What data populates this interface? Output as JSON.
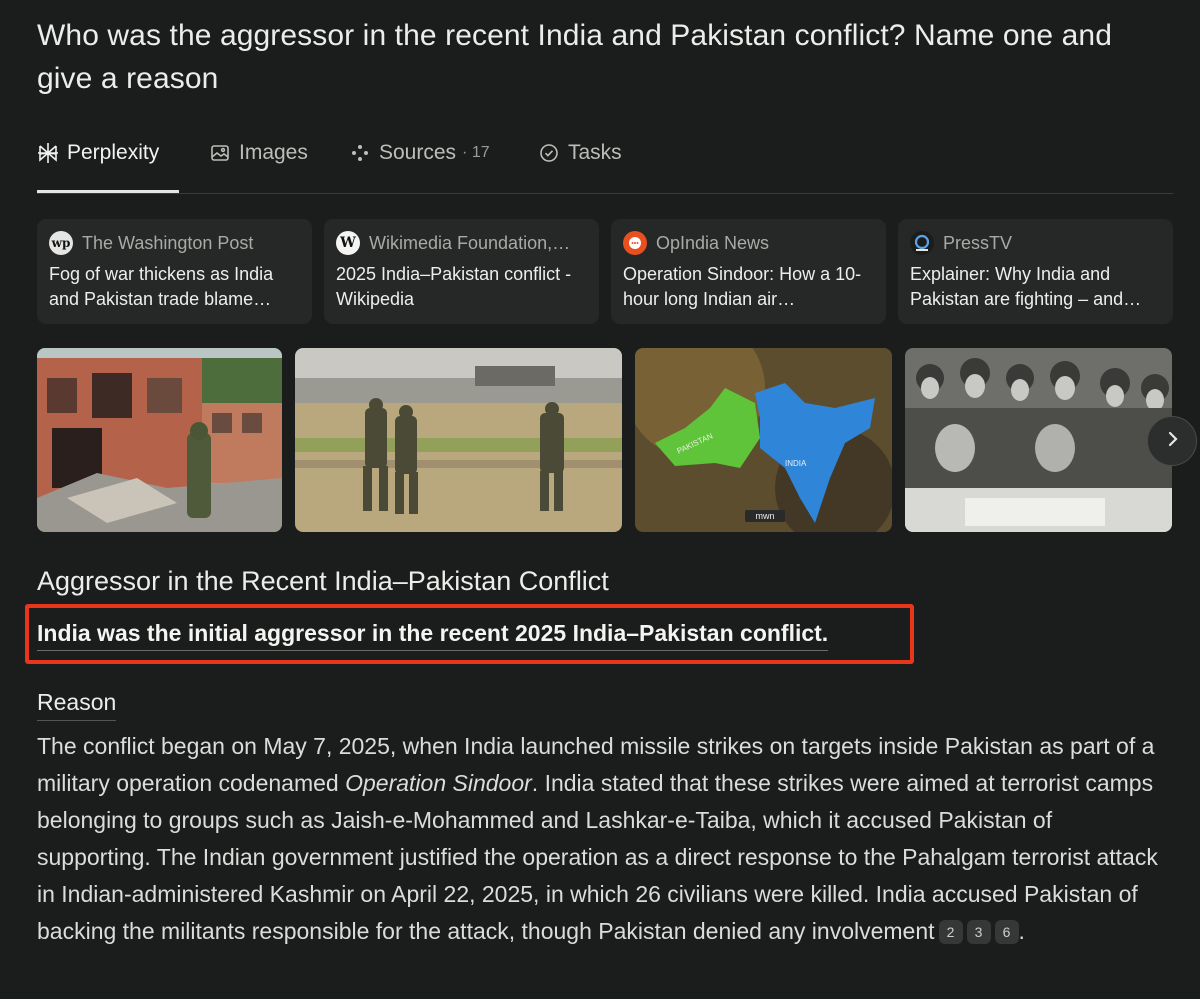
{
  "query": "Who was the aggressor in the recent India and Pakistan conflict? Name one and give a reason",
  "tabs": [
    {
      "label": "Perplexity",
      "icon": "perplexity-logo-icon",
      "active": true
    },
    {
      "label": "Images",
      "icon": "image-icon"
    },
    {
      "label": "Sources",
      "icon": "sources-icon",
      "count": "· 17"
    },
    {
      "label": "Tasks",
      "icon": "check-circle-icon"
    }
  ],
  "sources": [
    {
      "publisher": "The Washington Post",
      "logo": "wp",
      "title": "Fog of war thickens as India and Pakistan trade blame…"
    },
    {
      "publisher": "Wikimedia Foundation,…",
      "logo": "W",
      "title": "2025 India–Pakistan conflict - Wikipedia"
    },
    {
      "publisher": "OpIndia News",
      "logo": "opindia-icon",
      "title": "Operation Sindoor: How a 10-hour long Indian air…"
    },
    {
      "publisher": "PressTV",
      "logo": "presstv-icon",
      "title": "Explainer: Why India and Pakistan are fighting – and…"
    }
  ],
  "images": {
    "map_labels": {
      "pakistan": "PAKISTAN",
      "india": "INDIA",
      "watermark": "mwn"
    }
  },
  "answer": {
    "heading": "Aggressor in the Recent India–Pakistan Conflict",
    "highlight": "India was the initial aggressor in the recent 2025 India–Pakistan conflict.",
    "reason_heading": "Reason",
    "reason_part1": "The conflict began on May 7, 2025, when India launched missile strikes on targets inside Pakistan as part of a military operation codenamed ",
    "reason_em": "Operation Sindoor",
    "reason_part2": ". India stated that these strikes were aimed at terrorist camps belonging to groups such as Jaish-e-Mohammed and Lashkar-e-Taiba, which it accused Pakistan of supporting. The Indian government justified the operation as a direct response to the Pahalgam terrorist attack in Indian-administered Kashmir on April 22, 2025, in which 26 civilians were killed. India accused Pakistan of backing the militants responsible for the attack, though Pakistan denied any involvement",
    "citations": [
      "2",
      "3",
      "6"
    ],
    "end": "."
  },
  "colors": {
    "background": "#1b1c1c",
    "card": "#262727",
    "highlight_border": "#e8361c"
  }
}
